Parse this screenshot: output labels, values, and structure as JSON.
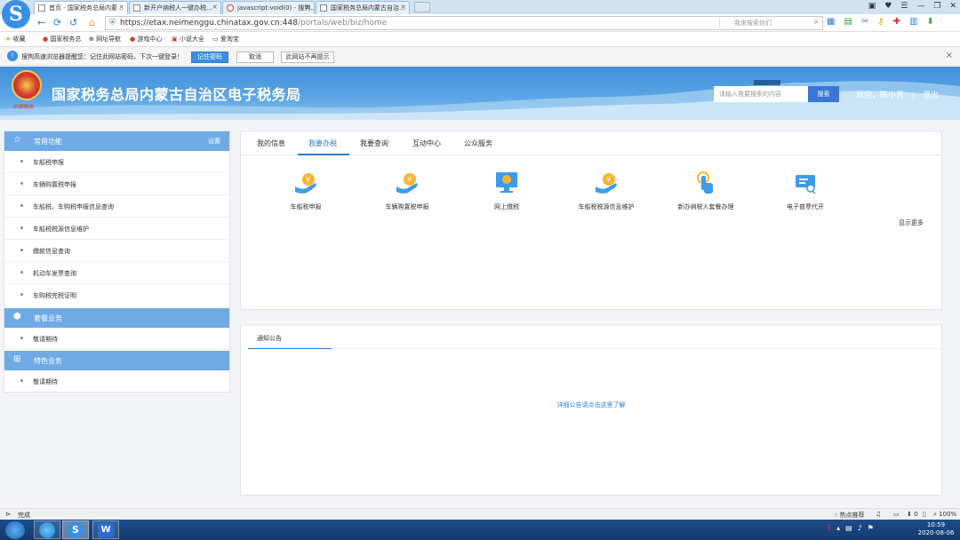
{
  "browser": {
    "tabs": [
      {
        "label": "首页 - 国家税务总局内蒙...",
        "active": true
      },
      {
        "label": "新开户纳税人一键办税...",
        "active": false
      },
      {
        "label": "javascript:void(0) - 搜狗...",
        "active": false
      },
      {
        "label": "国家税务总局内蒙古自治...",
        "active": false
      }
    ],
    "url_main": "https://etax.neimenggu.chinatax.gov.cn:448",
    "url_path": "/portals/web/biz/home",
    "search_placeholder": "我来搜索你们",
    "window_controls": [
      "▣",
      "♥",
      "☰",
      "—",
      "❐",
      "✕"
    ]
  },
  "bookmarks": [
    "收藏",
    "国家税务总",
    "网址导航",
    "游戏中心",
    "小说大全",
    "爱淘宝"
  ],
  "infobar": {
    "text": "搜狗高速浏览器提醒您：记住此网站密码，下次一键登录！",
    "remember": "记住密码",
    "cancel": "取消",
    "never": "此网站不再提示"
  },
  "header": {
    "site_title": "国家税务总局内蒙古自治区电子税务局",
    "emblem_sub": "中国税务",
    "search_placeholder": "请输入需要搜索的内容",
    "search_button": "搜索",
    "welcome": "欢迎，陈小芳",
    "logout": "退出"
  },
  "sidebar": {
    "common": {
      "title": "常用功能",
      "settings": "设置",
      "items": [
        "车船税申报",
        "车辆购置税申报",
        "车船税、车购税申报信息查询",
        "车船税税源信息维护",
        "缴款信息查询",
        "机动车发票查询",
        "车购税完税证明"
      ]
    },
    "package": {
      "title": "套餐业务",
      "items": [
        "敬请期待"
      ]
    },
    "special": {
      "title": "特色业务",
      "items": [
        "敬请期待"
      ]
    }
  },
  "main": {
    "tabs": [
      "我的信息",
      "我要办税",
      "我要查询",
      "互动中心",
      "公众服务"
    ],
    "active_tab": 1,
    "services": [
      {
        "label": "车船税申报",
        "icon": "hand-coin-icon"
      },
      {
        "label": "车辆购置税申报",
        "icon": "hand-coin-icon"
      },
      {
        "label": "网上缴税",
        "icon": "monitor-pay-icon"
      },
      {
        "label": "车船税税源信息维护",
        "icon": "hand-coin-icon"
      },
      {
        "label": "新办纳税人套餐办理",
        "icon": "touch-icon"
      },
      {
        "label": "电子普票代开",
        "icon": "ticket-icon"
      }
    ],
    "more": "显示更多"
  },
  "notice": {
    "tab": "通知公告",
    "link": "详细公告请点击这里了解"
  },
  "status": {
    "done": "完成",
    "hot": "热点推荐",
    "zoom": "100%",
    "zero": "0"
  },
  "taskbar": {
    "time": "10:59",
    "date": "2020-08-06"
  },
  "colors": {
    "accent": "#2b7cd3",
    "sidebar_head": "#6faae4",
    "banner": "#4a98de"
  }
}
